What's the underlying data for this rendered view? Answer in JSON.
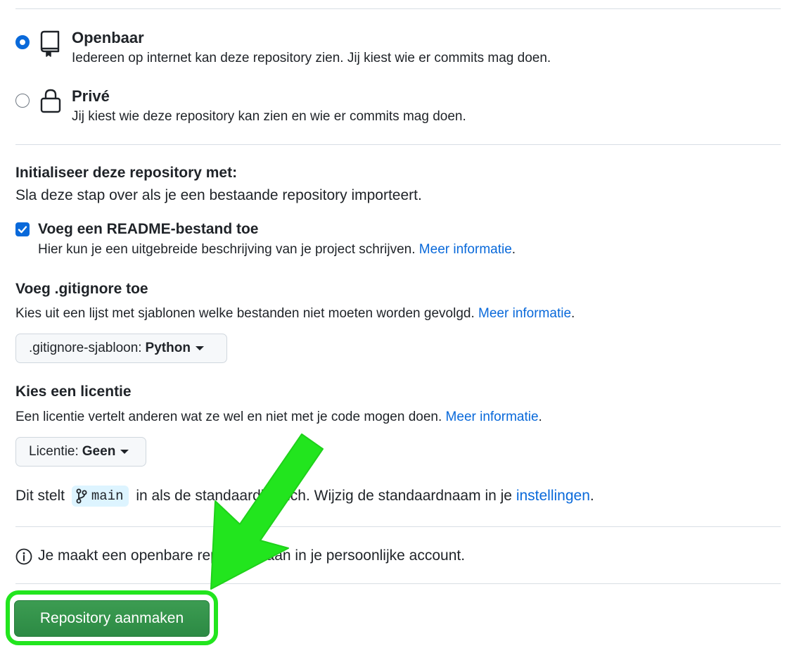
{
  "visibility": {
    "public": {
      "title": "Openbaar",
      "description": "Iedereen op internet kan deze repository zien. Jij kiest wie er commits mag doen.",
      "selected": true,
      "icon": "repo-icon"
    },
    "private": {
      "title": "Privé",
      "description": "Jij kiest wie deze repository kan zien en wie er commits mag doen.",
      "selected": false,
      "icon": "lock-icon"
    }
  },
  "initialize": {
    "heading": "Initialiseer deze repository met:",
    "subheading": "Sla deze stap over als je een bestaande repository importeert.",
    "readme": {
      "label": "Voeg een README-bestand toe",
      "checked": true,
      "description": "Hier kun je een uitgebreide beschrijving van je project schrijven.",
      "link": "Meer informatie"
    }
  },
  "gitignore": {
    "heading": "Voeg .gitignore toe",
    "description": "Kies uit een lijst met sjablonen welke bestanden niet moeten worden gevolgd.",
    "link": "Meer informatie",
    "select_prefix": ".gitignore-sjabloon:",
    "select_value": "Python"
  },
  "license": {
    "heading": "Kies een licentie",
    "description": "Een licentie vertelt anderen wat ze wel en niet met je code mogen doen.",
    "link": "Meer informatie",
    "select_prefix": "Licentie:",
    "select_value": "Geen"
  },
  "branch": {
    "text_before": "Dit stelt",
    "branch_name": "main",
    "text_after": "in als de standaardbranch. Wijzig de standaardnaam in je",
    "link": "instellingen",
    "trailing": "."
  },
  "notice": {
    "text": "Je maakt een openbare repository aan in je persoonlijke account."
  },
  "submit": {
    "label": "Repository aanmaken"
  },
  "colors": {
    "accent": "#0969da",
    "create_button": "#2c8a44",
    "highlight": "#22e51e",
    "branch_pill": "#ddf4ff"
  }
}
